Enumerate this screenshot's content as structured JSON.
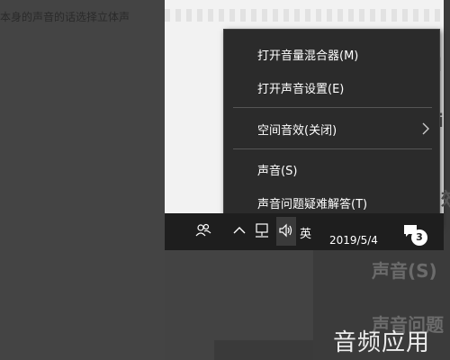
{
  "article": {
    "partial_line": "本身的声音的话选择立体声"
  },
  "context_menu": {
    "items": [
      {
        "label": "打开音量混合器(M)"
      },
      {
        "label": "打开声音设置(E)"
      },
      {
        "label": "空间音效(关闭)",
        "has_submenu": true
      },
      {
        "label": "声音(S)"
      },
      {
        "label": "声音问题疑难解答(T)"
      }
    ]
  },
  "taskbar": {
    "ime_label": "英",
    "date": "2019/5/4",
    "notification_count": "3",
    "icons": [
      "people-icon",
      "chevron-up-icon",
      "network-icon",
      "speaker-icon",
      "action-center-icon"
    ]
  },
  "background_ghost_text": {
    "sound": "声音(S)",
    "sound_trouble": "声音问题"
  },
  "watermark": "音频应用",
  "colors": {
    "menu_bg": "#2b2b2b",
    "taskbar_bg": "#1e1e1e",
    "text": "#ffffff",
    "separator": "#555555"
  }
}
